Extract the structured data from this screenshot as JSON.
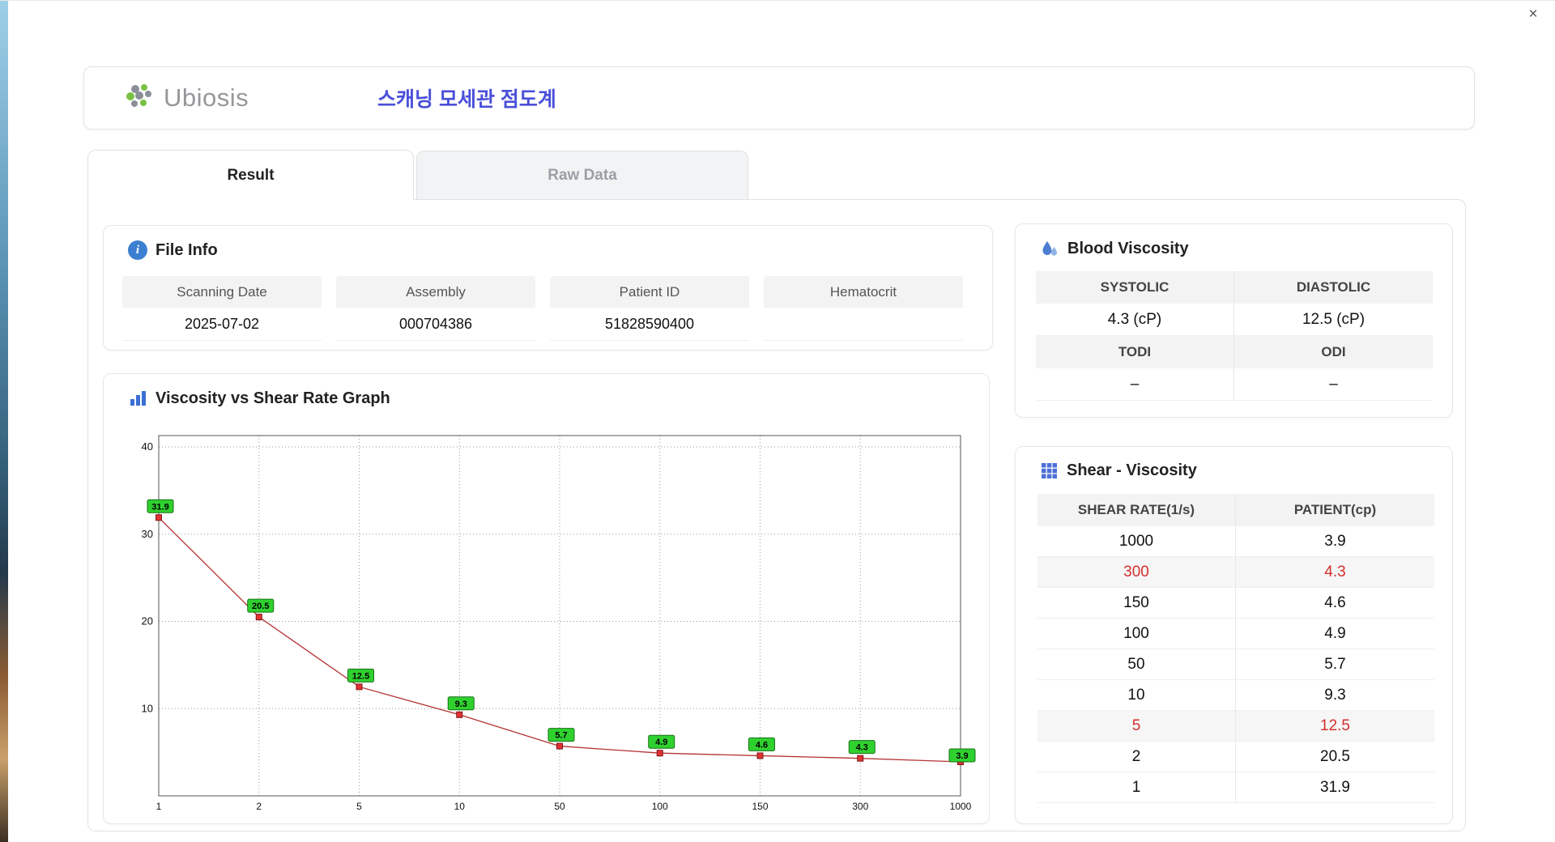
{
  "window": {
    "close": "×"
  },
  "header": {
    "brand": "Ubiosis",
    "title": "스캐닝 모세관 점도계"
  },
  "tabs": {
    "result": "Result",
    "raw_data": "Raw Data"
  },
  "file_info": {
    "title": "File Info",
    "fields": [
      {
        "label": "Scanning Date",
        "value": "2025-07-02"
      },
      {
        "label": "Assembly",
        "value": "000704386"
      },
      {
        "label": "Patient ID",
        "value": "51828590400"
      },
      {
        "label": "Hematocrit",
        "value": ""
      }
    ]
  },
  "blood_viscosity": {
    "title": "Blood Viscosity",
    "headers1": [
      "SYSTOLIC",
      "DIASTOLIC"
    ],
    "values1": [
      "4.3 (cP)",
      "12.5 (cP)"
    ],
    "headers2": [
      "TODI",
      "ODI"
    ],
    "values2": [
      "–",
      "–"
    ]
  },
  "shear_viscosity": {
    "title": "Shear - Viscosity",
    "columns": [
      "SHEAR RATE(1/s)",
      "PATIENT(cp)"
    ],
    "rows": [
      {
        "rate": "1000",
        "patient": "3.9",
        "highlight": false
      },
      {
        "rate": "300",
        "patient": "4.3",
        "highlight": true
      },
      {
        "rate": "150",
        "patient": "4.6",
        "highlight": false
      },
      {
        "rate": "100",
        "patient": "4.9",
        "highlight": false
      },
      {
        "rate": "50",
        "patient": "5.7",
        "highlight": false
      },
      {
        "rate": "10",
        "patient": "9.3",
        "highlight": false
      },
      {
        "rate": "5",
        "patient": "12.5",
        "highlight": true
      },
      {
        "rate": "2",
        "patient": "20.5",
        "highlight": false
      },
      {
        "rate": "1",
        "patient": "31.9",
        "highlight": false
      }
    ]
  },
  "chart_data": {
    "type": "line",
    "title": "Viscosity vs Shear Rate Graph",
    "categories": [
      "1",
      "2",
      "5",
      "10",
      "50",
      "100",
      "150",
      "300",
      "1000"
    ],
    "values": [
      31.9,
      20.5,
      12.5,
      9.3,
      5.7,
      4.9,
      4.6,
      4.3,
      3.9
    ],
    "xlabel": "",
    "ylabel": "",
    "x_scale": "categorical (log-spaced shear rates)",
    "ylim": [
      0,
      41.3
    ],
    "yticks": [
      10,
      20,
      30,
      40
    ],
    "grid": true,
    "legend": false,
    "line_color": "#b43232",
    "marker_color": "#e23232",
    "marker_border": "#7d1616",
    "label_bg": "#2fd12f",
    "label_border": "#157015"
  },
  "colors": {
    "accent_blue": "#4a4fd9",
    "icon_blue": "#3c7fd0",
    "highlight_red": "#d32f2f",
    "tab_inactive_bg": "#f1f3f4",
    "header_row_bg": "#f3f3f3"
  }
}
